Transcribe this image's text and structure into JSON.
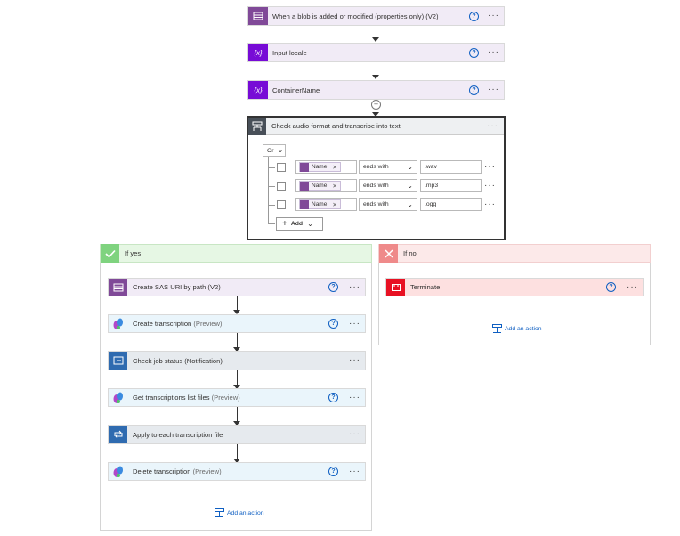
{
  "flow": {
    "trigger": {
      "title": "When a blob is added or modified (properties only) (V2)"
    },
    "input_locale": {
      "title": "Input locale"
    },
    "container_name": {
      "title": "ContainerName"
    },
    "condition": {
      "title": "Check audio format and transcribe into text",
      "operator": "Or",
      "rows": [
        {
          "token": "Name",
          "op": "ends with",
          "value": ".wav"
        },
        {
          "token": "Name",
          "op": "ends with",
          "value": ".mp3"
        },
        {
          "token": "Name",
          "op": "ends with",
          "value": ".ogg"
        }
      ],
      "add_label": "Add"
    },
    "if_yes": {
      "title": "If yes",
      "actions": [
        {
          "title": "Create SAS URI by path (V2)",
          "sub": ""
        },
        {
          "title": "Create transcription",
          "sub": "(Preview)"
        },
        {
          "title": "Check job status (Notification)",
          "sub": ""
        },
        {
          "title": "Get transcriptions list files",
          "sub": "(Preview)"
        },
        {
          "title": "Apply to each transcription file",
          "sub": ""
        },
        {
          "title": "Delete transcription",
          "sub": "(Preview)"
        }
      ],
      "add_action": "Add an action"
    },
    "if_no": {
      "title": "If no",
      "actions": [
        {
          "title": "Terminate"
        }
      ],
      "add_action": "Add an action"
    }
  },
  "icons": {
    "help": "?",
    "more": "···",
    "remove": "✕",
    "plus": "+",
    "chevron": "⌄"
  },
  "colors": {
    "blob": "#804998",
    "variable": "#770bd6",
    "condition": "#484f58",
    "speech": "#e8f3fb",
    "check": "#e6eef6",
    "terminate": "#e81123",
    "yes_header": "#e6f7e4",
    "no_header": "#fce9e9",
    "link": "#0f5fc2"
  }
}
